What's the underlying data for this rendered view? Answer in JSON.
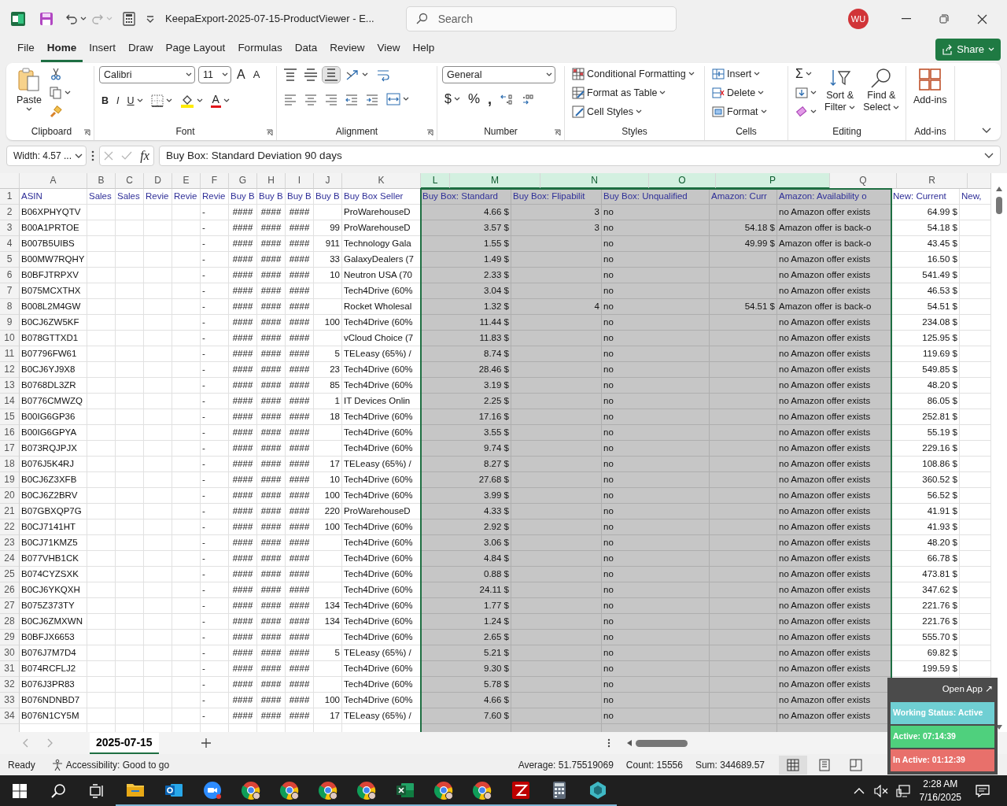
{
  "title_bar": {
    "title": "KeepaExport-2025-07-15-ProductViewer  -  E...",
    "search": {
      "placeholder": "Search"
    },
    "avatar": "WU"
  },
  "menu_tabs": [
    {
      "label": "File",
      "selected": false
    },
    {
      "label": "Home",
      "selected": true
    },
    {
      "label": "Insert",
      "selected": false
    },
    {
      "label": "Draw",
      "selected": false
    },
    {
      "label": "Page Layout",
      "selected": false
    },
    {
      "label": "Formulas",
      "selected": false
    },
    {
      "label": "Data",
      "selected": false
    },
    {
      "label": "Review",
      "selected": false
    },
    {
      "label": "View",
      "selected": false
    },
    {
      "label": "Help",
      "selected": false
    }
  ],
  "share_button": "Share",
  "ribbon": {
    "groups": [
      {
        "label": "Clipboard",
        "launcher": true
      },
      {
        "label": "Font",
        "launcher": true
      },
      {
        "label": "Alignment",
        "launcher": true
      },
      {
        "label": "Number",
        "launcher": true
      },
      {
        "label": "Styles",
        "launcher": false
      },
      {
        "label": "Cells",
        "launcher": false
      },
      {
        "label": "Editing",
        "launcher": false
      },
      {
        "label": "Add-ins",
        "launcher": false
      }
    ],
    "paste": "Paste",
    "font_name": "Calibri",
    "font_size": "11",
    "grow_font": "A",
    "shrink_font": "A",
    "bold": "B",
    "italic": "I",
    "underline": "U",
    "font_color": "A",
    "vertical_align": [
      {
        "selected": false
      },
      {
        "selected": false
      },
      {
        "selected": true
      }
    ],
    "number_format": "General",
    "currency": "$",
    "percent": "%",
    "comma": ",",
    "styles": [
      "Conditional Formatting",
      "Format as Table",
      "Cell Styles"
    ],
    "cells": [
      "Insert",
      "Delete",
      "Format"
    ],
    "autosum": "Σ",
    "sort_filter": [
      "Sort &",
      "Filter"
    ],
    "find_select": [
      "Find &",
      "Select"
    ],
    "addins": "Add-ins"
  },
  "formula_bar": {
    "name_box": "Width: 4.57 ...",
    "function_label": "fx",
    "formula": "Buy Box: Standard Deviation 90 days"
  },
  "grid": {
    "columns": [
      {
        "letter": "A",
        "selected": false
      },
      {
        "letter": "B",
        "selected": false
      },
      {
        "letter": "C",
        "selected": false
      },
      {
        "letter": "D",
        "selected": false
      },
      {
        "letter": "E",
        "selected": false
      },
      {
        "letter": "F",
        "selected": false
      },
      {
        "letter": "G",
        "selected": false
      },
      {
        "letter": "H",
        "selected": false
      },
      {
        "letter": "I",
        "selected": false
      },
      {
        "letter": "J",
        "selected": false
      },
      {
        "letter": "K",
        "selected": false
      },
      {
        "letter": "L",
        "selected": true
      },
      {
        "letter": "M",
        "selected": true
      },
      {
        "letter": "N",
        "selected": true
      },
      {
        "letter": "O",
        "selected": true
      },
      {
        "letter": "P",
        "selected": true
      },
      {
        "letter": "Q",
        "selected": false
      },
      {
        "letter": "R",
        "selected": false
      }
    ],
    "rows": [
      {
        "number": "1",
        "cells": {
          "A": "ASIN",
          "B": "Sales",
          "C": "Sales",
          "D": "Revie",
          "E": "Revie",
          "F": "Revie",
          "G": "Buy B",
          "H": "Buy B",
          "I": "Buy B",
          "J": "Buy B",
          "K": "Buy Box Seller",
          "L": "Buy Box: Standard",
          "M": "Buy Box: Flipabilit",
          "N": "Buy Box: Unqualified",
          "O": "Amazon: Curr",
          "P": "Amazon: Availability o",
          "Q": "New: Current",
          "R": "New,"
        }
      },
      {
        "number": "2",
        "cells": {
          "A": "B06XPHYQTV",
          "F": "-",
          "G": "####",
          "H": "####",
          "I": "####",
          "K": "ProWarehouseD",
          "L": "4.66 $",
          "M": "3",
          "N": "no",
          "P": "no Amazon offer exists",
          "Q": "64.99 $"
        }
      },
      {
        "number": "3",
        "cells": {
          "A": "B00A1PRTOE",
          "F": "-",
          "G": "####",
          "H": "####",
          "I": "####",
          "J": "99",
          "K": "ProWarehouseD",
          "L": "3.57 $",
          "M": "3",
          "N": "no",
          "O": "54.18 $",
          "P": "Amazon offer is back-o",
          "Q": "54.18 $"
        }
      },
      {
        "number": "4",
        "cells": {
          "A": "B007B5UIBS",
          "F": "-",
          "G": "####",
          "H": "####",
          "I": "####",
          "J": "911",
          "K": "Technology Gala",
          "L": "1.55 $",
          "N": "no",
          "O": "49.99 $",
          "P": "Amazon offer is back-o",
          "Q": "43.45 $"
        }
      },
      {
        "number": "5",
        "cells": {
          "A": "B00MW7RQHY",
          "F": "-",
          "G": "####",
          "H": "####",
          "I": "####",
          "J": "33",
          "K": "GalaxyDealers (7",
          "L": "1.49 $",
          "N": "no",
          "P": "no Amazon offer exists",
          "Q": "16.50 $"
        }
      },
      {
        "number": "6",
        "cells": {
          "A": "B0BFJTRPXV",
          "F": "-",
          "G": "####",
          "H": "####",
          "I": "####",
          "J": "10",
          "K": "Neutron USA (70",
          "L": "2.33 $",
          "N": "no",
          "P": "no Amazon offer exists",
          "Q": "541.49 $"
        }
      },
      {
        "number": "7",
        "cells": {
          "A": "B075MCXTHX",
          "F": "-",
          "G": "####",
          "H": "####",
          "I": "####",
          "K": "Tech4Drive (60%",
          "L": "3.04 $",
          "N": "no",
          "P": "no Amazon offer exists",
          "Q": "46.53 $"
        }
      },
      {
        "number": "8",
        "cells": {
          "A": "B008L2M4GW",
          "F": "-",
          "G": "####",
          "H": "####",
          "I": "####",
          "K": "Rocket Wholesal",
          "L": "1.32 $",
          "M": "4",
          "N": "no",
          "O": "54.51 $",
          "P": "Amazon offer is back-o",
          "Q": "54.51 $"
        }
      },
      {
        "number": "9",
        "cells": {
          "A": "B0CJ6ZW5KF",
          "F": "-",
          "G": "####",
          "H": "####",
          "I": "####",
          "J": "100",
          "K": "Tech4Drive (60%",
          "L": "11.44 $",
          "N": "no",
          "P": "no Amazon offer exists",
          "Q": "234.08 $"
        }
      },
      {
        "number": "10",
        "cells": {
          "A": "B078GTTXD1",
          "F": "-",
          "G": "####",
          "H": "####",
          "I": "####",
          "K": "vCloud Choice (7",
          "L": "11.83 $",
          "N": "no",
          "P": "no Amazon offer exists",
          "Q": "125.95 $"
        }
      },
      {
        "number": "11",
        "cells": {
          "A": "B07796FW61",
          "F": "-",
          "G": "####",
          "H": "####",
          "I": "####",
          "J": "5",
          "K": "TELeasy (65%) /",
          "L": "8.74 $",
          "N": "no",
          "P": "no Amazon offer exists",
          "Q": "119.69 $"
        }
      },
      {
        "number": "12",
        "cells": {
          "A": "B0CJ6YJ9X8",
          "F": "-",
          "G": "####",
          "H": "####",
          "I": "####",
          "J": "23",
          "K": "Tech4Drive (60%",
          "L": "28.46 $",
          "N": "no",
          "P": "no Amazon offer exists",
          "Q": "549.85 $"
        }
      },
      {
        "number": "13",
        "cells": {
          "A": "B0768DL3ZR",
          "F": "-",
          "G": "####",
          "H": "####",
          "I": "####",
          "J": "85",
          "K": "Tech4Drive (60%",
          "L": "3.19 $",
          "N": "no",
          "P": "no Amazon offer exists",
          "Q": "48.20 $"
        }
      },
      {
        "number": "14",
        "cells": {
          "A": "B0776CMWZQ",
          "F": "-",
          "G": "####",
          "H": "####",
          "I": "####",
          "J": "1",
          "K": "IT Devices Onlin",
          "L": "2.25 $",
          "N": "no",
          "P": "no Amazon offer exists",
          "Q": "86.05 $"
        }
      },
      {
        "number": "15",
        "cells": {
          "A": "B00IG6GP36",
          "F": "-",
          "G": "####",
          "H": "####",
          "I": "####",
          "J": "18",
          "K": "Tech4Drive (60%",
          "L": "17.16 $",
          "N": "no",
          "P": "no Amazon offer exists",
          "Q": "252.81 $"
        }
      },
      {
        "number": "16",
        "cells": {
          "A": "B00IG6GPYA",
          "F": "-",
          "G": "####",
          "H": "####",
          "I": "####",
          "K": "Tech4Drive (60%",
          "L": "3.55 $",
          "N": "no",
          "P": "no Amazon offer exists",
          "Q": "55.19 $"
        }
      },
      {
        "number": "17",
        "cells": {
          "A": "B073RQJPJX",
          "F": "-",
          "G": "####",
          "H": "####",
          "I": "####",
          "K": "Tech4Drive (60%",
          "L": "9.74 $",
          "N": "no",
          "P": "no Amazon offer exists",
          "Q": "229.16 $"
        }
      },
      {
        "number": "18",
        "cells": {
          "A": "B076J5K4RJ",
          "F": "-",
          "G": "####",
          "H": "####",
          "I": "####",
          "J": "17",
          "K": "TELeasy (65%) /",
          "L": "8.27 $",
          "N": "no",
          "P": "no Amazon offer exists",
          "Q": "108.86 $"
        }
      },
      {
        "number": "19",
        "cells": {
          "A": "B0CJ6Z3XFB",
          "F": "-",
          "G": "####",
          "H": "####",
          "I": "####",
          "J": "10",
          "K": "Tech4Drive (60%",
          "L": "27.68 $",
          "N": "no",
          "P": "no Amazon offer exists",
          "Q": "360.52 $"
        }
      },
      {
        "number": "20",
        "cells": {
          "A": "B0CJ6Z2BRV",
          "F": "-",
          "G": "####",
          "H": "####",
          "I": "####",
          "J": "100",
          "K": "Tech4Drive (60%",
          "L": "3.99 $",
          "N": "no",
          "P": "no Amazon offer exists",
          "Q": "56.52 $"
        }
      },
      {
        "number": "21",
        "cells": {
          "A": "B07GBXQP7G",
          "F": "-",
          "G": "####",
          "H": "####",
          "I": "####",
          "J": "220",
          "K": "ProWarehouseD",
          "L": "4.33 $",
          "N": "no",
          "P": "no Amazon offer exists",
          "Q": "41.91 $"
        }
      },
      {
        "number": "22",
        "cells": {
          "A": "B0CJ7141HT",
          "F": "-",
          "G": "####",
          "H": "####",
          "I": "####",
          "J": "100",
          "K": "Tech4Drive (60%",
          "L": "2.92 $",
          "N": "no",
          "P": "no Amazon offer exists",
          "Q": "41.93 $"
        }
      },
      {
        "number": "23",
        "cells": {
          "A": "B0CJ71KMZ5",
          "F": "-",
          "G": "####",
          "H": "####",
          "I": "####",
          "K": "Tech4Drive (60%",
          "L": "3.06 $",
          "N": "no",
          "P": "no Amazon offer exists",
          "Q": "48.20 $"
        }
      },
      {
        "number": "24",
        "cells": {
          "A": "B077VHB1CK",
          "F": "-",
          "G": "####",
          "H": "####",
          "I": "####",
          "K": "Tech4Drive (60%",
          "L": "4.84 $",
          "N": "no",
          "P": "no Amazon offer exists",
          "Q": "66.78 $"
        }
      },
      {
        "number": "25",
        "cells": {
          "A": "B074CYZSXK",
          "F": "-",
          "G": "####",
          "H": "####",
          "I": "####",
          "K": "Tech4Drive (60%",
          "L": "0.88 $",
          "N": "no",
          "P": "no Amazon offer exists",
          "Q": "473.81 $"
        }
      },
      {
        "number": "26",
        "cells": {
          "A": "B0CJ6YKQXH",
          "F": "-",
          "G": "####",
          "H": "####",
          "I": "####",
          "K": "Tech4Drive (60%",
          "L": "24.11 $",
          "N": "no",
          "P": "no Amazon offer exists",
          "Q": "347.62 $"
        }
      },
      {
        "number": "27",
        "cells": {
          "A": "B075Z373TY",
          "F": "-",
          "G": "####",
          "H": "####",
          "I": "####",
          "J": "134",
          "K": "Tech4Drive (60%",
          "L": "1.77 $",
          "N": "no",
          "P": "no Amazon offer exists",
          "Q": "221.76 $"
        }
      },
      {
        "number": "28",
        "cells": {
          "A": "B0CJ6ZMXWN",
          "F": "-",
          "G": "####",
          "H": "####",
          "I": "####",
          "J": "134",
          "K": "Tech4Drive (60%",
          "L": "1.24 $",
          "N": "no",
          "P": "no Amazon offer exists",
          "Q": "221.76 $"
        }
      },
      {
        "number": "29",
        "cells": {
          "A": "B0BFJX6653",
          "F": "-",
          "G": "####",
          "H": "####",
          "I": "####",
          "K": "Tech4Drive (60%",
          "L": "2.65 $",
          "N": "no",
          "P": "no Amazon offer exists",
          "Q": "555.70 $"
        }
      },
      {
        "number": "30",
        "cells": {
          "A": "B076J7M7D4",
          "F": "-",
          "G": "####",
          "H": "####",
          "I": "####",
          "J": "5",
          "K": "TELeasy (65%) /",
          "L": "5.21 $",
          "N": "no",
          "P": "no Amazon offer exists",
          "Q": "69.82 $"
        }
      },
      {
        "number": "31",
        "cells": {
          "A": "B074RCFLJ2",
          "F": "-",
          "G": "####",
          "H": "####",
          "I": "####",
          "K": "Tech4Drive (60%",
          "L": "9.30 $",
          "N": "no",
          "P": "no Amazon offer exists",
          "Q": "199.59 $"
        }
      },
      {
        "number": "32",
        "cells": {
          "A": "B076J3PR83",
          "F": "-",
          "G": "####",
          "H": "####",
          "I": "####",
          "K": "Tech4Drive (60%",
          "L": "5.78 $",
          "N": "no",
          "P": "no Amazon offer exists"
        }
      },
      {
        "number": "33",
        "cells": {
          "A": "B076NDNBD7",
          "F": "-",
          "G": "####",
          "H": "####",
          "I": "####",
          "J": "100",
          "K": "Tech4Drive (60%",
          "L": "4.66 $",
          "N": "no",
          "P": "no Amazon offer exists"
        }
      },
      {
        "number": "34",
        "cells": {
          "A": "B076N1CY5M",
          "F": "-",
          "G": "####",
          "H": "####",
          "I": "####",
          "J": "17",
          "K": "TELeasy (65%) /",
          "L": "7.60 $",
          "N": "no",
          "P": "no Amazon offer exists"
        }
      }
    ]
  },
  "sheet_tabs": [
    {
      "label": "2025-07-15",
      "selected": true
    }
  ],
  "status_bar": {
    "mode": "Ready",
    "accessibility": "Accessibility: Good to go",
    "average": "Average: 51.75519069",
    "count": "Count: 15556",
    "sum": "Sum: 344689.57",
    "views": [
      {
        "selected": true
      },
      {
        "selected": false
      },
      {
        "selected": false
      }
    ]
  },
  "tracker_widget": {
    "open_app": "Open App ↗",
    "status": "Working Status: Active",
    "active": "Active: 07:14:39",
    "inactive": "In Active: 01:12:39"
  },
  "taskbar": {
    "apps": [
      {
        "kind": "folder"
      },
      {
        "kind": "mail"
      },
      {
        "kind": "meeting"
      },
      {
        "kind": "browser"
      },
      {
        "kind": "browser"
      },
      {
        "kind": "browser"
      },
      {
        "kind": "browser"
      },
      {
        "kind": "spreadsheet"
      },
      {
        "kind": "browser"
      },
      {
        "kind": "browser"
      },
      {
        "kind": "ftp"
      },
      {
        "kind": "calculator"
      },
      {
        "kind": "hexagon"
      }
    ],
    "time": "2:28 AM",
    "date": "7/16/2025"
  }
}
